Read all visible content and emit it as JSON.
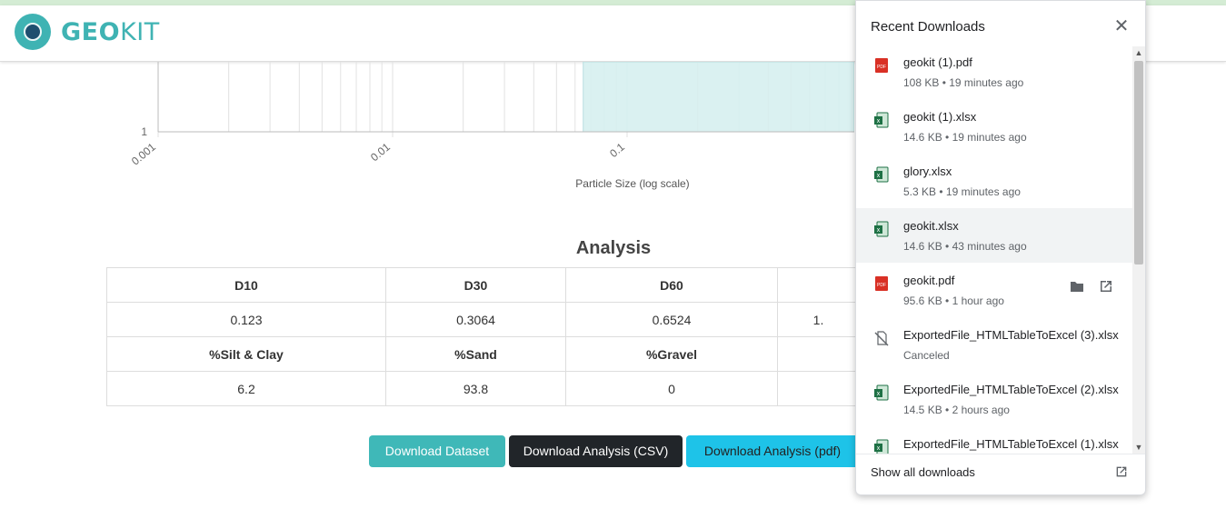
{
  "header": {
    "logo_bold": "GEO",
    "logo_light": "KIT"
  },
  "chart_data": {
    "type": "line",
    "title": "",
    "xlabel": "Particle Size (log scale)",
    "ylabel": "",
    "x_scale": "log",
    "xlim": [
      0.001,
      1
    ],
    "x_ticks": [
      "0.001",
      "0.01",
      "0.1"
    ],
    "y_ticks": [
      "1"
    ],
    "shaded_region": {
      "x_start": 0.065,
      "x_end": 1,
      "color": "#d6eff0"
    },
    "series": []
  },
  "analysis": {
    "title": "Analysis",
    "headers_1": [
      "D10",
      "D30",
      "D60",
      ""
    ],
    "values_1": [
      "0.123",
      "0.3064",
      "0.6524",
      "1."
    ],
    "headers_2": [
      "%Silt & Clay",
      "%Sand",
      "%Gravel",
      ""
    ],
    "values_2": [
      "6.2",
      "93.8",
      "0",
      ""
    ]
  },
  "buttons": {
    "dataset": "Download Dataset",
    "csv": "Download Analysis (CSV)",
    "pdf": "Download Analysis (pdf)"
  },
  "downloads": {
    "title": "Recent Downloads",
    "show_all": "Show all downloads",
    "items": [
      {
        "name": "geokit (1).pdf",
        "meta": "108 KB • 19 minutes ago",
        "icon": "pdf-file-icon"
      },
      {
        "name": "geokit (1).xlsx",
        "meta": "14.6 KB • 19 minutes ago",
        "icon": "excel-file-icon"
      },
      {
        "name": "glory.xlsx",
        "meta": "5.3 KB • 19 minutes ago",
        "icon": "excel-file-icon"
      },
      {
        "name": "geokit.xlsx",
        "meta": "14.6 KB • 43 minutes ago",
        "icon": "excel-file-icon"
      },
      {
        "name": "geokit.pdf",
        "meta": "95.6 KB • 1 hour ago",
        "icon": "pdf-file-icon"
      },
      {
        "name": "ExportedFile_HTMLTableToExcel (3).xlsx",
        "meta": "Canceled",
        "icon": "canceled-file-icon"
      },
      {
        "name": "ExportedFile_HTMLTableToExcel (2).xlsx",
        "meta": "14.5 KB • 2 hours ago",
        "icon": "excel-file-icon"
      },
      {
        "name": "ExportedFile_HTMLTableToExcel (1).xlsx",
        "meta": "",
        "icon": "excel-file-icon"
      }
    ]
  }
}
